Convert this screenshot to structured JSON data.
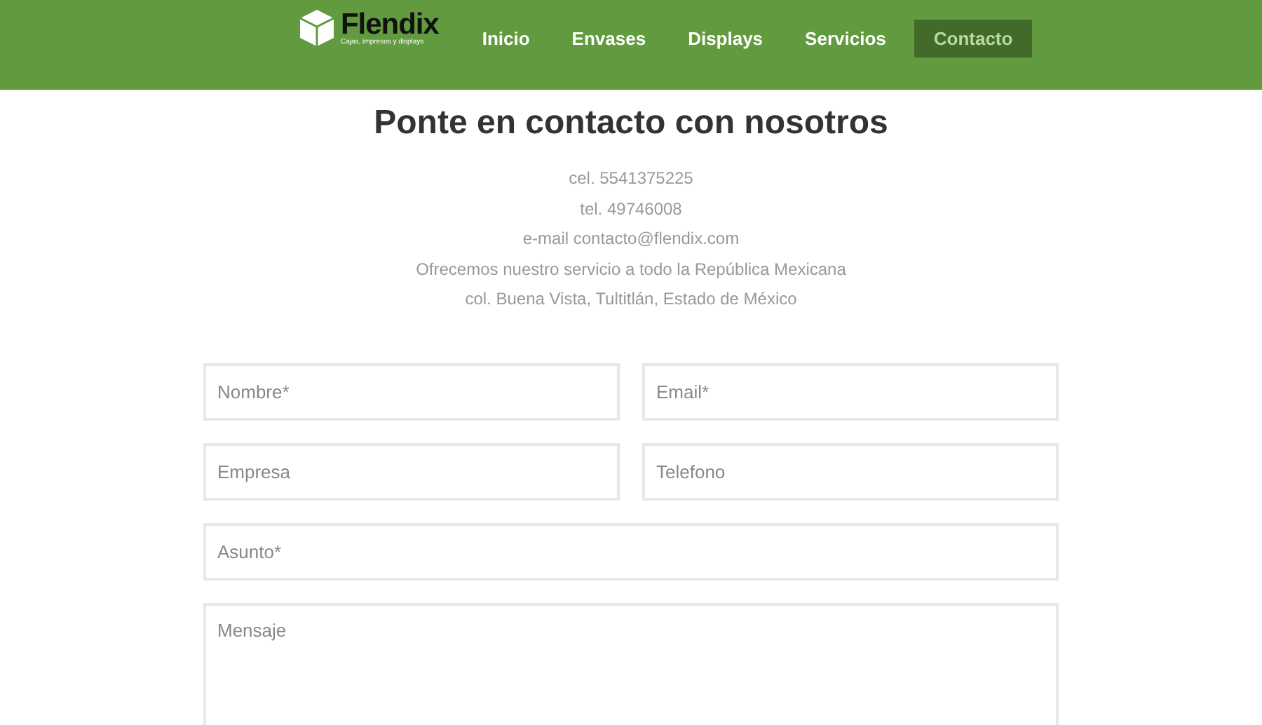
{
  "header": {
    "logo": {
      "name": "Flendix",
      "tagline": "Cajas, impresos y displays"
    },
    "nav": [
      {
        "label": "Inicio",
        "selected": false
      },
      {
        "label": "Envases",
        "selected": false
      },
      {
        "label": "Displays",
        "selected": false
      },
      {
        "label": "Servicios",
        "selected": false
      },
      {
        "label": "Contacto",
        "selected": true
      }
    ]
  },
  "contact": {
    "title": "Ponte en contacto con nosotros",
    "lines": [
      "cel. 5541375225",
      "tel. 49746008",
      "e-mail contacto@flendix.com",
      "Ofrecemos nuestro servicio a todo la República Mexicana",
      "col. Buena Vista, Tultitlán, Estado de México"
    ]
  },
  "form": {
    "rows": [
      [
        {
          "kind": "input",
          "placeholder": "Nombre*"
        },
        {
          "kind": "input",
          "placeholder": "Email*"
        }
      ],
      [
        {
          "kind": "input",
          "placeholder": "Empresa"
        },
        {
          "kind": "input",
          "placeholder": "Telefono"
        }
      ],
      [
        {
          "kind": "input",
          "placeholder": "Asunto*"
        }
      ],
      [
        {
          "kind": "textarea",
          "placeholder": "Mensaje"
        }
      ]
    ]
  }
}
